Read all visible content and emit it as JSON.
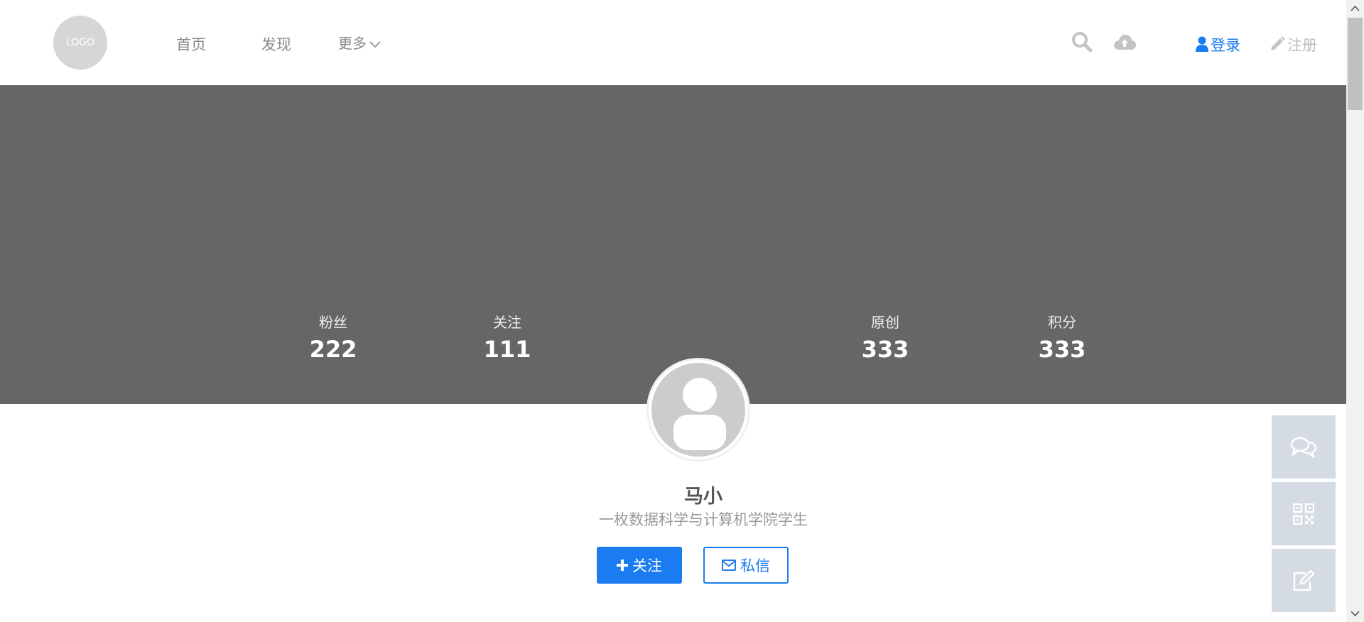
{
  "header": {
    "logo_text": "LOGO",
    "nav": {
      "home": "首页",
      "discover": "发现",
      "more": "更多"
    },
    "login": "登录",
    "register": "注册"
  },
  "profile": {
    "stats": {
      "fans": {
        "label": "粉丝",
        "value": "222"
      },
      "following": {
        "label": "关注",
        "value": "111"
      },
      "original": {
        "label": "原创",
        "value": "333"
      },
      "points": {
        "label": "积分",
        "value": "333"
      }
    },
    "name": "马小",
    "bio": "一枚数据科学与计算机学院学生",
    "follow_button": "关注",
    "message_button": "私信"
  },
  "side_tools": [
    "chat-icon",
    "qrcode-icon",
    "edit-icon"
  ],
  "icons": [
    "search-icon",
    "cloud-upload-icon",
    "user-icon",
    "pencil-icon",
    "chevron-down-icon",
    "plus-icon",
    "envelope-icon"
  ],
  "colors": {
    "accent": "#1a7cf0",
    "banner": "#666666",
    "side_tool_bg": "#d5dbe2"
  }
}
